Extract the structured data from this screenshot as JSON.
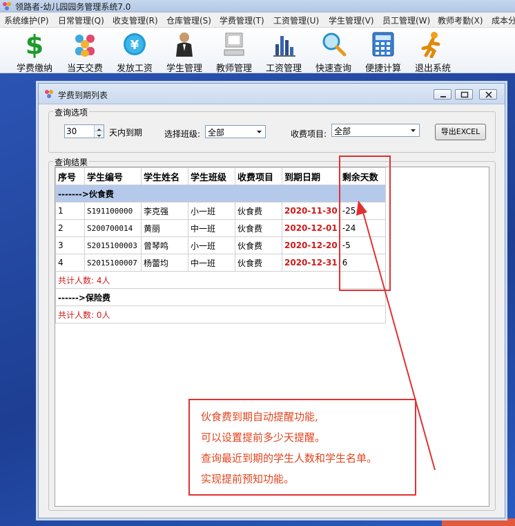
{
  "app": {
    "title": "领路者-幼儿园园务管理系统7.0"
  },
  "menu": [
    "系统维护(P)",
    "日常管理(Q)",
    "收支管理(R)",
    "仓库管理(S)",
    "学费管理(T)",
    "工资管理(U)",
    "学生管理(V)",
    "员工管理(W)",
    "教师考勤(X)",
    "成本分"
  ],
  "toolbar": [
    {
      "label": "学费缴纳",
      "icon": "dollar-icon"
    },
    {
      "label": "当天交费",
      "icon": "people-icon"
    },
    {
      "label": "发放工资",
      "icon": "yen-coin-icon"
    },
    {
      "label": "学生管理",
      "icon": "person-suit-icon"
    },
    {
      "label": "教师管理",
      "icon": "computer-icon"
    },
    {
      "label": "工资管理",
      "icon": "bar-chart-icon"
    },
    {
      "label": "快速查询",
      "icon": "magnifier-icon"
    },
    {
      "label": "便捷计算",
      "icon": "calculator-icon"
    },
    {
      "label": "退出系统",
      "icon": "running-man-icon"
    }
  ],
  "window": {
    "title": "学费到期列表"
  },
  "query": {
    "legend": "查询选项",
    "days_value": "30",
    "days_suffix": "天内到期",
    "class_label": "选择班级:",
    "class_value": "全部",
    "fee_label": "收费项目:",
    "fee_value": "全部",
    "export_label": "导出EXCEL"
  },
  "results": {
    "legend": "查询结果",
    "columns": [
      "序号",
      "学生编号",
      "学生姓名",
      "学生班级",
      "收费项目",
      "到期日期",
      "剩余天数"
    ],
    "groups": [
      {
        "header": "------->伙食费",
        "rows": [
          [
            "1",
            "S191100000",
            "李克强",
            "小一班",
            "伙食费",
            "2020-11-30",
            "-25"
          ],
          [
            "2",
            "S200700014",
            "黄丽",
            "中一班",
            "伙食费",
            "2020-12-01",
            "-24"
          ],
          [
            "3",
            "S2015100003",
            "曾琴鸣",
            "小一班",
            "伙食费",
            "2020-12-20",
            "-5"
          ],
          [
            "4",
            "S2015100007",
            "杨蕾均",
            "中一班",
            "伙食费",
            "2020-12-31",
            "6"
          ]
        ],
        "summary": "共计人数: 4人"
      },
      {
        "header": "------>保险费",
        "rows": [],
        "summary": "共计人数: 0人"
      }
    ]
  },
  "callout": {
    "lines": [
      "伙食费到期自动提醒功能,",
      "可以设置提前多少天提醒。",
      "查询最近到期的学生人数和学生名单。",
      "实现提前预知功能。"
    ]
  },
  "colors": {
    "annotation_red": "#e23030",
    "date_red": "#d01a1a",
    "group_header_bg": "#b5c9ea",
    "desktop_blue": "#1f3f8c"
  }
}
